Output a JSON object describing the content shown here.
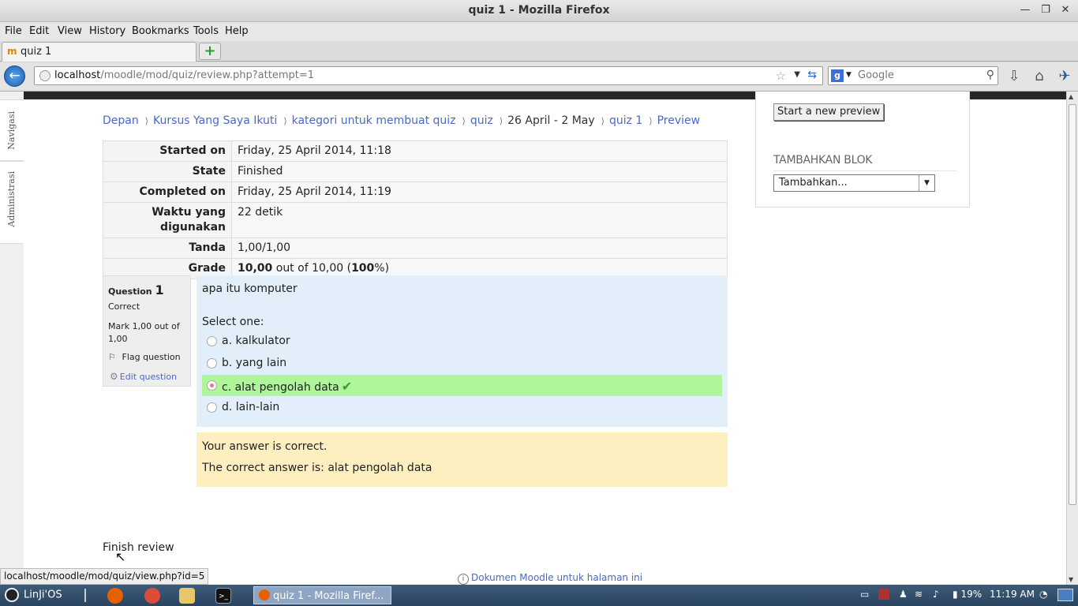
{
  "window": {
    "title": "quiz 1 - Mozilla Firefox"
  },
  "menu": [
    "File",
    "Edit",
    "View",
    "History",
    "Bookmarks",
    "Tools",
    "Help"
  ],
  "tab": {
    "label": "quiz 1"
  },
  "nav": {
    "url_host": "localhost",
    "url_path": "/moodle/mod/quiz/review.php?attempt=1",
    "search_placeholder": "Google"
  },
  "dock": {
    "navigasi": "Navigasi",
    "administrasi": "Administrasi"
  },
  "breadcrumb": {
    "items": [
      "Depan",
      "Kursus Yang Saya Ikuti",
      "kategori untuk membuat quiz",
      "quiz",
      "26 April - 2 May",
      "quiz 1",
      "Preview"
    ],
    "separator": "⟩"
  },
  "summary": [
    {
      "label": "Started on",
      "value": "Friday, 25 April 2014, 11:18"
    },
    {
      "label": "State",
      "value": "Finished"
    },
    {
      "label": "Completed on",
      "value": "Friday, 25 April 2014, 11:19"
    },
    {
      "label": "Waktu yang digunakan",
      "value": "22 detik"
    },
    {
      "label": "Tanda",
      "value": "1,00/1,00"
    },
    {
      "label": "Grade",
      "value_strong": "10,00",
      "value_mid": " out of 10,00 (",
      "value_pct": "100",
      "value_end": "%)"
    }
  ],
  "question": {
    "label": "Question",
    "number": "1",
    "state": "Correct",
    "mark": "Mark 1,00 out of 1,00",
    "flag": "Flag question",
    "edit": "Edit question",
    "text": "apa itu komputer",
    "prompt": "Select one:",
    "answers": [
      {
        "text": "a. kalkulator",
        "selected": false
      },
      {
        "text": "b. yang lain",
        "selected": false
      },
      {
        "text": "c. alat pengolah data",
        "selected": true
      },
      {
        "text": "d. lain-lain",
        "selected": false
      }
    ],
    "feedback_1": "Your answer is correct.",
    "feedback_2": "The correct answer is: alat pengolah data"
  },
  "finish_review": "Finish review",
  "docs_link": "Dokumen Moodle untuk halaman ini",
  "side": {
    "preview_button": "Start a new preview",
    "add_block_title": "TAMBAHKAN BLOK",
    "add_block_select": "Tambahkan..."
  },
  "status_url": "localhost/moodle/mod/quiz/view.php?id=5",
  "taskbar": {
    "start": "LinJi'OS",
    "task": "quiz 1 - Mozilla Firef...",
    "battery": "19%",
    "clock": "11:19 AM"
  },
  "colors": {
    "link": "#4a68c8",
    "correct_bg": "#aff59a",
    "question_bg": "#e2eef9",
    "feedback_bg": "#fdefc0"
  }
}
